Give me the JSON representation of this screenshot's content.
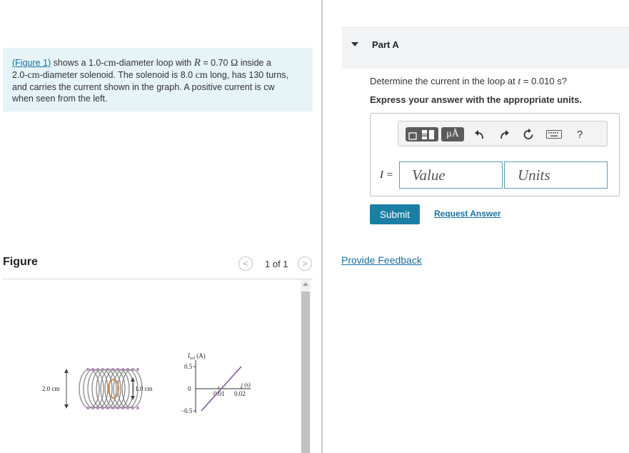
{
  "problem": {
    "figure_link": "(Figure 1)",
    "text_a": " shows a 1.0-",
    "cm": "cm",
    "text_b": "-diameter loop with ",
    "R": "R",
    "eq_val": " = 0.70 ",
    "ohm": "Ω",
    "text_c": " inside a",
    "text_d": "2.0-",
    "text_e": "-diameter solenoid. The solenoid is 8.0 ",
    "text_f": " long, has 130 turns,",
    "line3": "and carries the current shown in the graph. A positive current is cw",
    "line4": "when seen from the left."
  },
  "figure": {
    "title": "Figure",
    "prev_glyph": "<",
    "next_glyph": ">",
    "pager": "1 of 1",
    "diam_outer": "2.0 cm",
    "diam_inner": "1.0 cm",
    "ylabel": "I",
    "ylabel_sub": "sol",
    "ylabel_unit": " (A)",
    "ytick_top": "0.5",
    "ytick_zero": "0",
    "ytick_bottom": "−0.5",
    "xtick_1": "0.01",
    "xtick_2": "0.02",
    "xlabel": "t (s)"
  },
  "part_a": {
    "title": "Part A",
    "question_pre": "Determine the current in the loop at ",
    "t": "t",
    "question_post": " = 0.010 s?",
    "instruction": "Express your answer with the appropriate units.",
    "toolbar": {
      "units_btn": "μÅ",
      "help": "?"
    },
    "var_label": "I =",
    "value_placeholder": "Value",
    "units_placeholder": "Units",
    "submit": "Submit",
    "request_answer": "Request Answer"
  },
  "feedback": "Provide Feedback",
  "colors": {
    "accent": "#1b7fa5",
    "link": "#1a6fa0",
    "problem_bg": "#e6f3f7",
    "coil": "#8a8a8a",
    "loop": "#c58a5a"
  }
}
